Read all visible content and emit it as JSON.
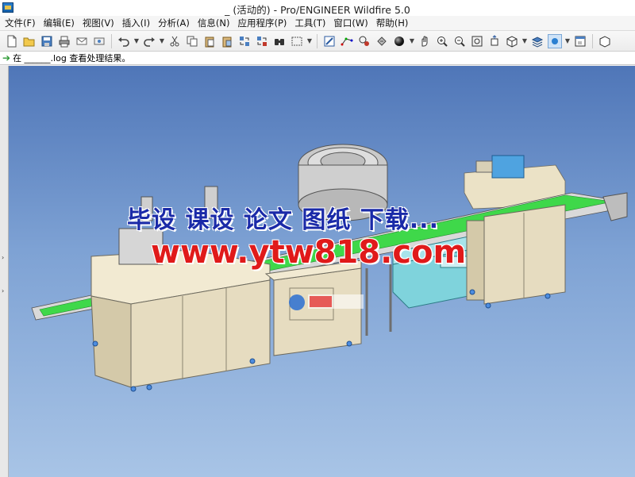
{
  "window": {
    "title": "_ (活动的) - Pro/ENGINEER Wildfire 5.0"
  },
  "menubar": {
    "items": [
      "文件(F)",
      "编辑(E)",
      "视图(V)",
      "插入(I)",
      "分析(A)",
      "信息(N)",
      "应用程序(P)",
      "工具(T)",
      "窗口(W)",
      "帮助(H)"
    ]
  },
  "toolbar": {
    "icons": [
      "new-icon",
      "open-icon",
      "save-icon",
      "print-icon",
      "send-email-icon",
      "email-icon",
      "undo-icon",
      "redo-icon",
      "cut-icon",
      "copy-icon",
      "paste-icon",
      "paste-special-icon",
      "regenerate-icon",
      "regen-manager-icon",
      "find-icon",
      "select-box-icon",
      "repaint-icon",
      "spin-center-icon",
      "saved-views-icon",
      "layers-icon",
      "shading-icon",
      "pan-icon",
      "zoom-in-icon",
      "zoom-out-icon",
      "refit-icon",
      "reorient-icon",
      "view-manager-icon",
      "layer-tree-icon",
      "appearance-icon",
      "window-icon"
    ]
  },
  "message": {
    "text": "在 ______.log 查看处理结果。"
  },
  "watermark": {
    "line1": "毕设 课设 论文 图纸 下载...",
    "line2": "www.ytw818.com"
  },
  "colors": {
    "viewport_top": "#4f76b8",
    "viewport_bottom": "#a8c4e6",
    "machine_frame": "#e6dcc0",
    "conveyor_belt": "#3fd84a",
    "watermark_blue": "#1a2aa8",
    "watermark_red": "#e01a1a"
  }
}
